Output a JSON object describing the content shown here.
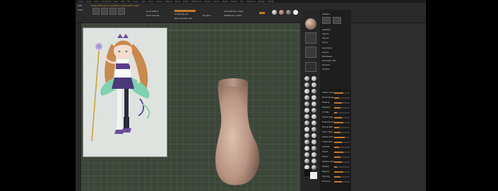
{
  "menu": [
    "Alpha",
    "Brush",
    "Color",
    "Document",
    "Draw",
    "Edit",
    "File",
    "Layer",
    "Light",
    "Macro",
    "Marker",
    "Material",
    "Movie",
    "Picker",
    "Preferences",
    "Render",
    "Stencil",
    "Stroke",
    "Texture",
    "Tool",
    "Transform",
    "Zplugin",
    "Zscript"
  ],
  "topbar": {
    "hint": "Press Shift+Ctrl to reposition; Press shift to align",
    "mode_a": "Edit",
    "mode_b": "Draw",
    "focal_shift": "Focal Shift 0",
    "draw_size": "Draw Size 64",
    "dynamic": "Dynamic",
    "active_points": "ActivePoints: 2,064",
    "total_points": "TotalPoints: 2,064",
    "z_intensity": "Z Intensity 25",
    "rgb_intensity": "Rgb Intensity 100"
  },
  "panel": {
    "subtool_label": "SubTool",
    "top_items": [
      "Lightbox",
      "Import",
      "Export",
      "Clone"
    ],
    "menu_list": [
      "Geometry",
      "Layers",
      "FiberMesh",
      "Geometry HD",
      "Preview",
      "Surface"
    ],
    "rows": [
      {
        "label": "Visible Count",
        "value": 0.6
      },
      {
        "label": "Morph Target",
        "value": 0.3
      },
      {
        "label": "Masking",
        "value": 0.5
      },
      {
        "label": "Polypaint",
        "value": 0.4
      },
      {
        "label": "UV Map",
        "value": 0.2
      },
      {
        "label": "Texture Map",
        "value": 0.5
      },
      {
        "label": "Displacement",
        "value": 0.6
      },
      {
        "label": "Normal Map",
        "value": 0.3
      },
      {
        "label": "Vector Displ",
        "value": 0.4
      },
      {
        "label": "Display Prop",
        "value": 0.7
      },
      {
        "label": "Unified Skin",
        "value": 0.5
      },
      {
        "label": "Initialize",
        "value": 0.3
      },
      {
        "label": "Import",
        "value": 0.6
      },
      {
        "label": "Export",
        "value": 0.4
      },
      {
        "label": "Adaptive Skin",
        "value": 0.5
      },
      {
        "label": "ZSketch",
        "value": 0.2
      },
      {
        "label": "Rigging",
        "value": 0.6
      },
      {
        "label": "Topology",
        "value": 0.4
      },
      {
        "label": "Projection",
        "value": 0.5
      }
    ]
  },
  "colors": {
    "accent": "#c47a28",
    "viewport": "#3c4639",
    "mesh": "#c8a896"
  }
}
